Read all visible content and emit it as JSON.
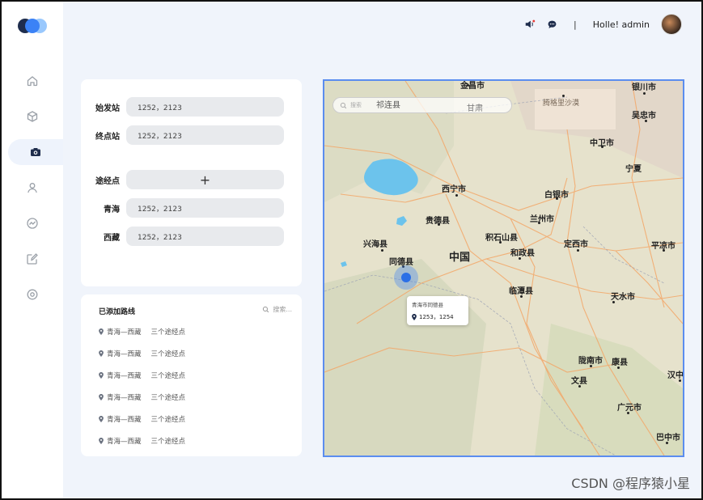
{
  "header": {
    "greeting": "Holle! admin",
    "separator": "|"
  },
  "sidebar": {
    "items": [
      {
        "icon": "home-icon"
      },
      {
        "icon": "box-icon"
      },
      {
        "icon": "camera-icon",
        "active": true
      },
      {
        "icon": "user-icon"
      },
      {
        "icon": "chart-icon"
      },
      {
        "icon": "edit-icon"
      },
      {
        "icon": "settings-icon"
      }
    ]
  },
  "form": {
    "start": {
      "label": "始发站",
      "value": "1252，2123"
    },
    "end": {
      "label": "终点站",
      "value": "1252，2123"
    },
    "waypoint": {
      "label": "途经点",
      "add": "+"
    },
    "qinghai": {
      "label": "青海",
      "value": "1252，2123"
    },
    "xizang": {
      "label": "西藏",
      "value": "1252，2123"
    }
  },
  "routes": {
    "title": "已添加路线",
    "search_placeholder": "搜索...",
    "items": [
      {
        "route": "青海—西藏",
        "via": "三个途经点"
      },
      {
        "route": "青海—西藏",
        "via": "三个途经点"
      },
      {
        "route": "青海—西藏",
        "via": "三个途经点"
      },
      {
        "route": "青海—西藏",
        "via": "三个途经点"
      },
      {
        "route": "青海—西藏",
        "via": "三个途经点"
      },
      {
        "route": "青海—西藏",
        "via": "三个途经点"
      }
    ]
  },
  "map": {
    "search_placeholder": "搜索",
    "labels": {
      "jinchang": "金昌市",
      "yinchuan": "银川市",
      "qilian": "祁连县",
      "gansu": "甘肃",
      "tengger": "腾格里沙漠",
      "wuzhong": "吴忠市",
      "zhongwei": "中卫市",
      "ningxia": "宁夏",
      "xining": "西宁市",
      "baiyin": "白银市",
      "guide": "贵德县",
      "lanzhou": "兰州市",
      "xinghai": "兴海县",
      "jishishan": "积石山县",
      "dingxi": "定西市",
      "pingliang": "平凉市",
      "tongde": "同德县",
      "china": "中国",
      "hezheng": "和政县",
      "lintan": "临潭县",
      "tianshui": "天水市",
      "longnan": "陇南市",
      "kangxian": "康县",
      "wenxian": "文县",
      "hanzhong": "汉中",
      "guangyuan": "广元市",
      "bazhong": "巴中市"
    },
    "popup": {
      "title": "青海市同德县",
      "coords": "1253，1254"
    }
  },
  "watermark": "CSDN @程序猿小星",
  "colors": {
    "accent": "#2b6fe6",
    "map_border": "#5b8def",
    "field_bg": "#e8eaed",
    "page_bg": "#f0f4fb"
  }
}
